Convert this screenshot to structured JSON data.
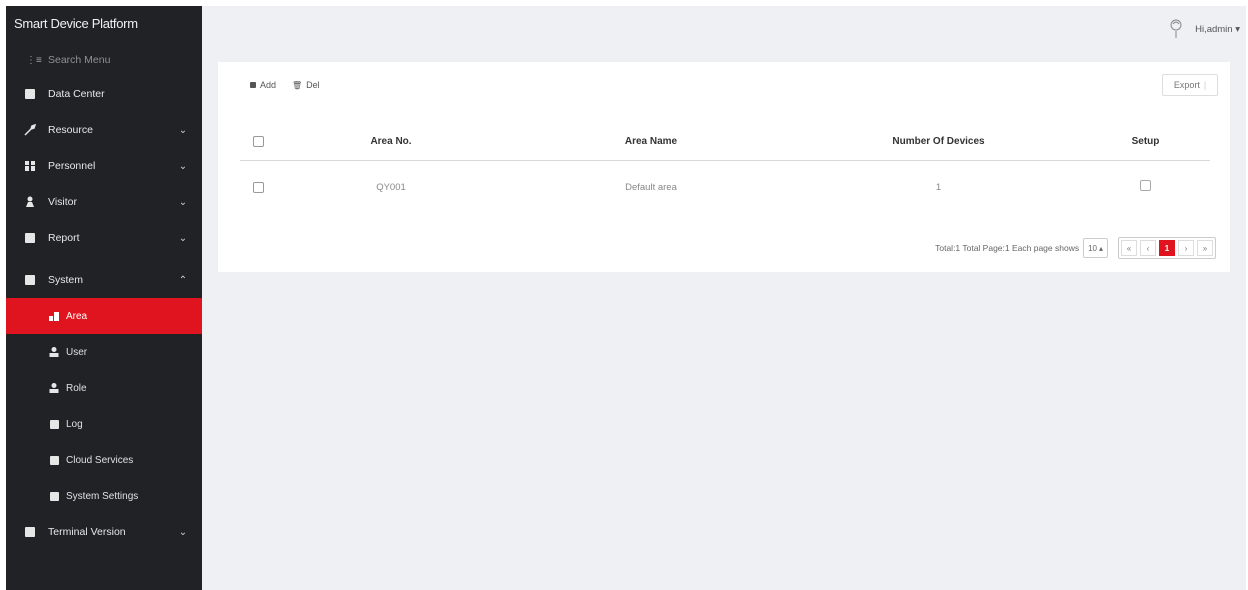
{
  "app": {
    "title": "Smart Device Platform"
  },
  "search": {
    "placeholder": "Search Menu"
  },
  "sidebar": {
    "items": [
      {
        "label": "Data Center",
        "icon": "monitor-icon"
      },
      {
        "label": "Resource",
        "icon": "wrench-icon"
      },
      {
        "label": "Personnel",
        "icon": "people-icon"
      },
      {
        "label": "Visitor",
        "icon": "person-icon"
      },
      {
        "label": "Report",
        "icon": "monitor-icon"
      },
      {
        "label": "System",
        "icon": "system-icon"
      }
    ],
    "system_sub": [
      {
        "label": "Area",
        "icon": "area-icon"
      },
      {
        "label": "User",
        "icon": "user-icon"
      },
      {
        "label": "Role",
        "icon": "role-icon"
      },
      {
        "label": "Log",
        "icon": "log-icon"
      },
      {
        "label": "Cloud Services",
        "icon": "cloud-icon"
      },
      {
        "label": "System Settings",
        "icon": "settings-icon"
      }
    ],
    "terminal": {
      "label": "Terminal Version",
      "icon": "terminal-icon"
    }
  },
  "user": {
    "name": "Hi,admin"
  },
  "toolbar": {
    "add_label": "Add",
    "del_label": "Del",
    "export_label": "Export"
  },
  "table": {
    "columns": [
      "Area No.",
      "Area Name",
      "Number Of Devices",
      "Setup"
    ],
    "rows": [
      {
        "area_no": "QY001",
        "area_name": "Default area",
        "devices": "1"
      }
    ]
  },
  "pagination": {
    "summary": "Total:1 Total Page:1 Each page shows",
    "page_size": "10",
    "current_page": "1"
  },
  "colors": {
    "accent": "#e0141e",
    "sidebar_bg": "#202226",
    "content_bg": "#eef0f3"
  }
}
